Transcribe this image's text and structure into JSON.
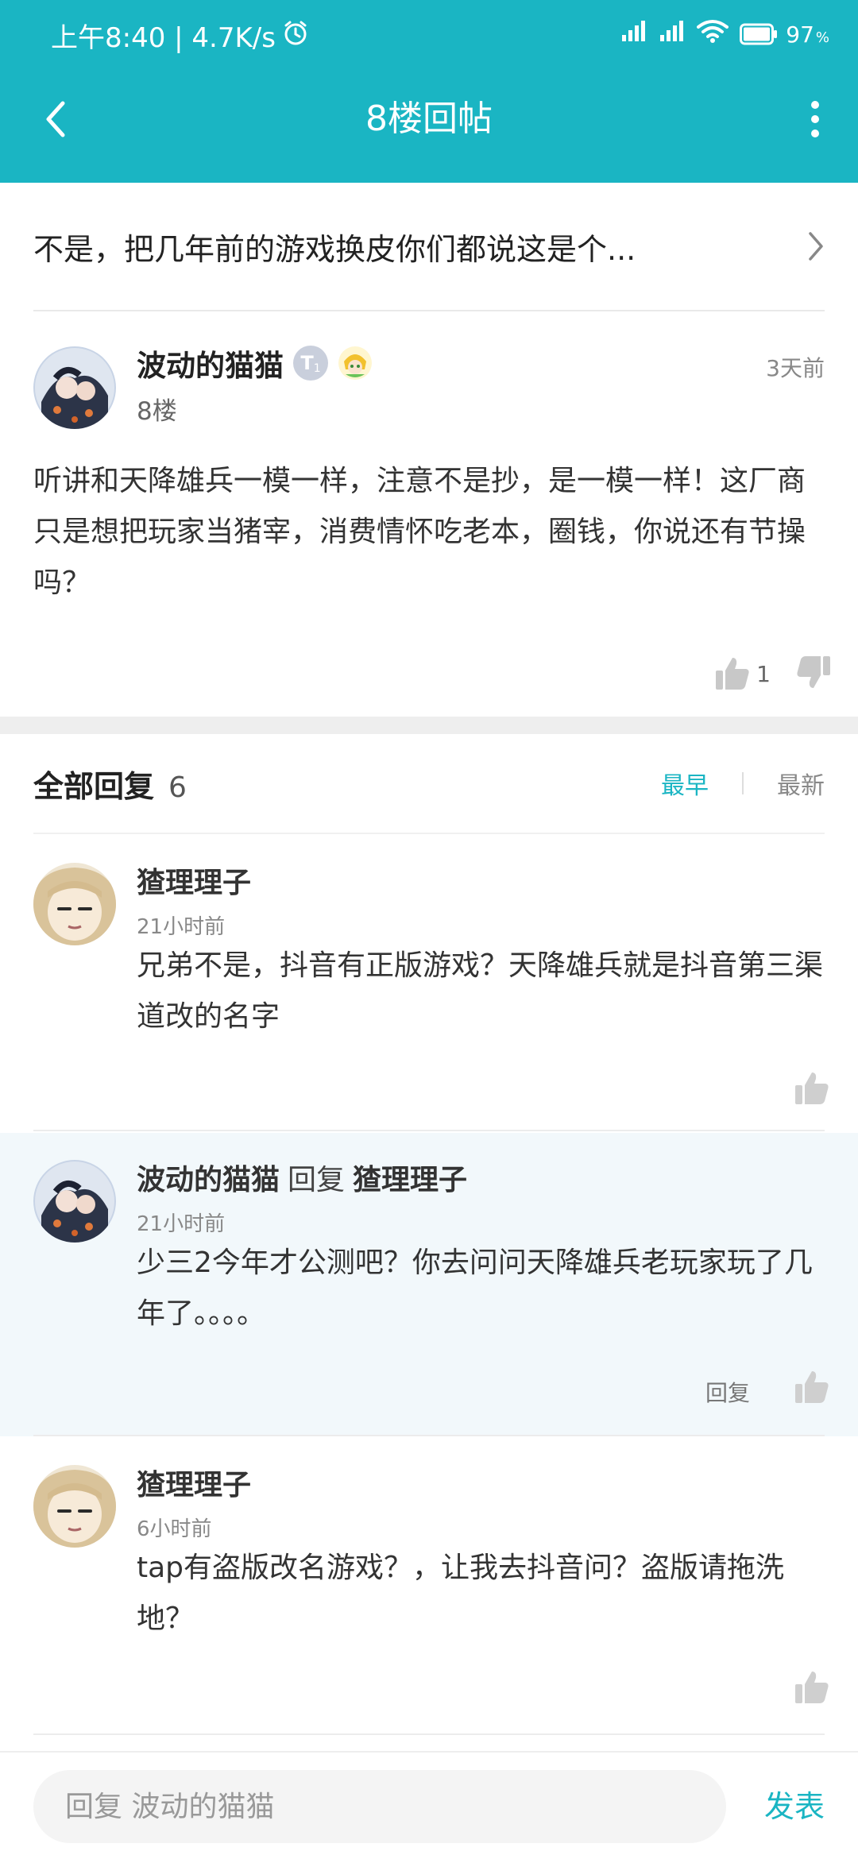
{
  "status_bar": {
    "time_speed": "上午8:40 | 4.7K/s",
    "battery_pct": "97",
    "battery_unit": "%"
  },
  "nav": {
    "title": "8楼回帖",
    "back_icon": "chevron-left-icon",
    "more_icon": "more-vertical-icon"
  },
  "thread": {
    "title": "不是，把几年前的游戏换皮你们都说这是个..."
  },
  "post": {
    "author": "波动的猫猫",
    "badge_level": "T",
    "badge_sub": "1",
    "floor": "8楼",
    "time": "3天前",
    "body": "听讲和天降雄兵一模一样，注意不是抄，是一模一样！这厂商只是想把玩家当猪宰，消费情怀吃老本，圈钱，你说还有节操吗？",
    "like_count": "1"
  },
  "replies_section": {
    "title": "全部回复",
    "count": "6",
    "sort_earliest": "最早",
    "sort_latest": "最新"
  },
  "replies": [
    {
      "author": "猹理理子",
      "time": "21小时前",
      "body": "兄弟不是，抖音有正版游戏？天降雄兵就是抖音第三渠道改的名字"
    },
    {
      "author": "波动的猫猫",
      "reply_word": "回复",
      "reply_to": "猹理理子",
      "time": "21小时前",
      "body": "少三2今年才公测吧？你去问问天降雄兵老玩家玩了几年了。。。。",
      "reply_label": "回复"
    },
    {
      "author": "猹理理子",
      "time": "6小时前",
      "body": "tap有盗版改名游戏？，让我去抖音问？盗版请拖洗地？"
    }
  ],
  "bottom_bar": {
    "placeholder": "回复 波动的猫猫",
    "send_label": "发表"
  },
  "colors": {
    "accent": "#1ab5c3",
    "highlight_bg": "#f2f8fb"
  }
}
